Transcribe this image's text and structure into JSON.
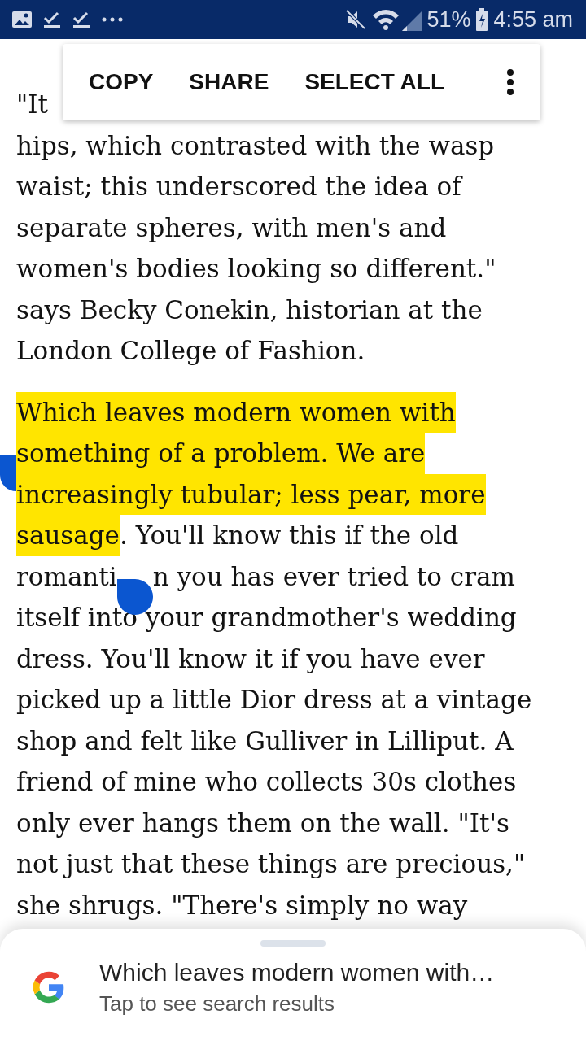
{
  "status_bar": {
    "battery": "51%",
    "time": "4:55 am"
  },
  "selection_menu": {
    "items": [
      "COPY",
      "SHARE",
      "SELECT ALL"
    ]
  },
  "article": {
    "paragraphs": [
      {
        "lines": [
          {
            "segments": [
              {
                "kind": "text",
                "text": "\"It",
                "selected": false
              }
            ]
          },
          {
            "segments": [
              {
                "kind": "text",
                "text": "hips, which contrasted with the wasp",
                "selected": false
              }
            ]
          },
          {
            "segments": [
              {
                "kind": "text",
                "text": "waist; this underscored the idea of",
                "selected": false
              }
            ]
          },
          {
            "segments": [
              {
                "kind": "text",
                "text": "separate spheres, with men's and",
                "selected": false
              }
            ]
          },
          {
            "segments": [
              {
                "kind": "text",
                "text": "women's bodies looking so different.\"",
                "selected": false
              }
            ]
          },
          {
            "segments": [
              {
                "kind": "text",
                "text": "says Becky Conekin, historian at the",
                "selected": false
              }
            ]
          },
          {
            "segments": [
              {
                "kind": "text",
                "text": "London College of Fashion.",
                "selected": false
              }
            ]
          }
        ]
      },
      {
        "lines": [
          {
            "segments": [
              {
                "kind": "text",
                "text": "Which leaves modern women with",
                "selected": true
              }
            ]
          },
          {
            "segments": [
              {
                "kind": "handle_start"
              },
              {
                "kind": "text",
                "text": "something of a problem. We are",
                "selected": true
              }
            ]
          },
          {
            "segments": [
              {
                "kind": "text",
                "text": "increasingly tubular; less pear, more",
                "selected": true
              }
            ]
          },
          {
            "segments": [
              {
                "kind": "text",
                "text": "sausage",
                "selected": true
              },
              {
                "kind": "text",
                "text": ". You'll know this if the old",
                "selected": false
              }
            ]
          },
          {
            "segments": [
              {
                "kind": "text",
                "text": "romanti",
                "selected": false
              },
              {
                "kind": "handle_end"
              },
              {
                "kind": "text",
                "text": "n you has ever tried to cram",
                "selected": false
              }
            ]
          },
          {
            "segments": [
              {
                "kind": "text",
                "text": "itself into your grandmother's wedding",
                "selected": false
              }
            ]
          },
          {
            "segments": [
              {
                "kind": "text",
                "text": "dress. You'll know it if you have ever",
                "selected": false
              }
            ]
          },
          {
            "segments": [
              {
                "kind": "text",
                "text": "picked up a little Dior dress at a vintage",
                "selected": false
              }
            ]
          },
          {
            "segments": [
              {
                "kind": "text",
                "text": "shop and felt like Gulliver in Lilliput. A",
                "selected": false
              }
            ]
          },
          {
            "segments": [
              {
                "kind": "text",
                "text": "friend of mine who collects 30s clothes",
                "selected": false
              }
            ]
          },
          {
            "segments": [
              {
                "kind": "text",
                "text": "only ever hangs them on the wall. \"It's",
                "selected": false
              }
            ]
          },
          {
            "segments": [
              {
                "kind": "text",
                "text": "not just that these things are precious,\"",
                "selected": false
              }
            ]
          },
          {
            "segments": [
              {
                "kind": "text",
                "text": "she shrugs. \"There's simply no way",
                "selected": false
              }
            ]
          }
        ]
      }
    ]
  },
  "search_sheet": {
    "title": "Which leaves modern women with…",
    "subtitle": "Tap to see search results"
  }
}
